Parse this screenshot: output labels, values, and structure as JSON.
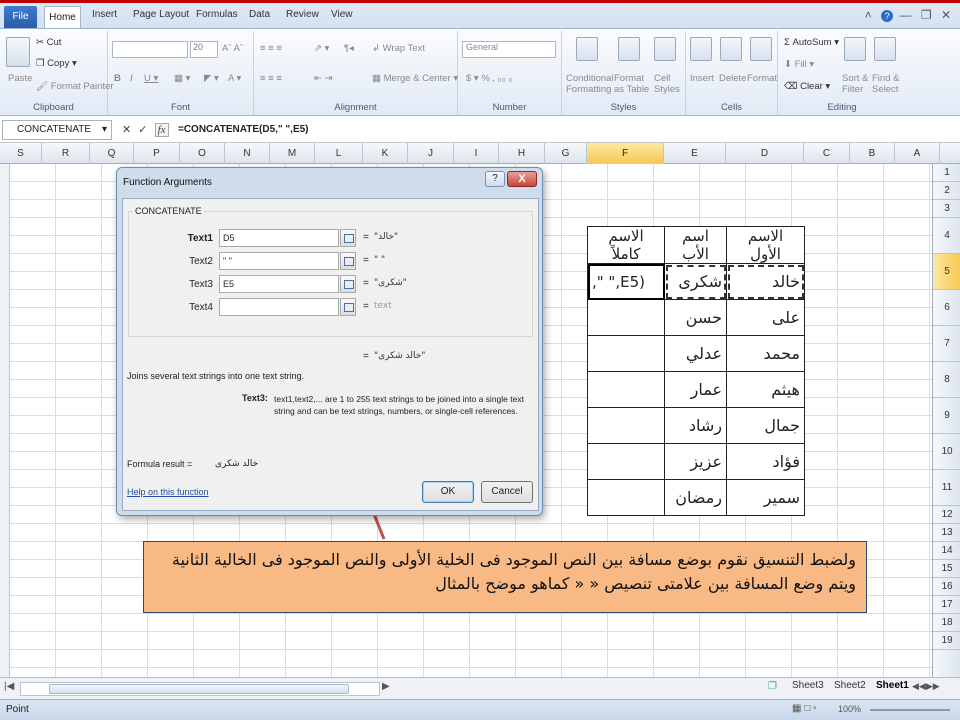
{
  "tabs": {
    "file": "File",
    "home": "Home",
    "items": [
      "Insert",
      "Page Layout",
      "Formulas",
      "Data",
      "Review",
      "View"
    ]
  },
  "ribbon": {
    "clipboard": {
      "label": "Clipboard",
      "paste": "Paste",
      "cut": "Cut",
      "copy": "Copy",
      "format_painter": "Format Painter"
    },
    "font": {
      "label": "Font",
      "size": "20"
    },
    "alignment": {
      "label": "Alignment",
      "wrap": "Wrap Text",
      "merge": "Merge & Center"
    },
    "number": {
      "label": "Number",
      "format": "General"
    },
    "styles": {
      "label": "Styles",
      "conditional": "Conditional",
      "conditional2": "Formatting",
      "format_as": "Format",
      "format_as2": "as Table",
      "cell_styles": "Cell",
      "cell_styles2": "Styles"
    },
    "cells": {
      "label": "Cells",
      "insert": "Insert",
      "delete": "Delete",
      "format": "Format"
    },
    "editing": {
      "label": "Editing",
      "autosum": "AutoSum",
      "fill": "Fill",
      "clear": "Clear",
      "sort": "Sort &",
      "sort2": "Filter",
      "find": "Find &",
      "find2": "Select"
    }
  },
  "formula_bar": {
    "name_box": "CONCATENATE",
    "formula": "=CONCATENATE(D5,\" \",E5)"
  },
  "columns": [
    "S",
    "R",
    "Q",
    "P",
    "O",
    "N",
    "M",
    "L",
    "K",
    "J",
    "I",
    "H",
    "G",
    "F",
    "E",
    "D",
    "C",
    "B",
    "A"
  ],
  "rows": [
    "1",
    "2",
    "3",
    "4",
    "5",
    "6",
    "7",
    "8",
    "9",
    "10",
    "11",
    "12",
    "13",
    "14",
    "15",
    "16",
    "17",
    "18",
    "19"
  ],
  "selected_column": "F",
  "selected_row": "5",
  "sheet": {
    "headers": {
      "full_name": "الاسم كاملاً",
      "father": "اسم الأب",
      "first": "الاسم الأول"
    },
    "rows": [
      {
        "full": ",\" \",E5)",
        "father": "شكرى",
        "first": "خالد"
      },
      {
        "full": "",
        "father": "حسن",
        "first": "على"
      },
      {
        "full": "",
        "father": "عدلي",
        "first": "محمد"
      },
      {
        "full": "",
        "father": "عمار",
        "first": "هيثم"
      },
      {
        "full": "",
        "father": "رشاد",
        "first": "جمال"
      },
      {
        "full": "",
        "father": "عزيز",
        "first": "فؤاد"
      },
      {
        "full": "",
        "father": "رمضان",
        "first": "سمير"
      }
    ]
  },
  "dialog": {
    "title": "Function Arguments",
    "help": "?",
    "close": "X",
    "function_name": "CONCATENATE",
    "args": [
      {
        "label": "Text1",
        "value": "D5",
        "result": "\"خالد\""
      },
      {
        "label": "Text2",
        "value": "\" \"",
        "result": "\" \""
      },
      {
        "label": "Text3",
        "value": "E5",
        "result": "\"شكرى\""
      },
      {
        "label": "Text4",
        "value": "",
        "result": "text"
      }
    ],
    "total_result": "\"خالد شكرى\"",
    "description": "Joins several text strings into one text string.",
    "arg_desc_name": "Text3:",
    "arg_desc": "text1,text2,... are 1 to 255 text strings to be joined into a single text string and can be text strings, numbers, or single-cell references.",
    "formula_result_label": "Formula result =",
    "formula_result": "خالد شكرى",
    "help_link": "Help on this function",
    "ok": "OK",
    "cancel": "Cancel"
  },
  "callout": {
    "text": "ولضبط التنسيق نقوم بوضع مسافة بين النص الموجود فى الخلية الأولى والنص الموجود فى الخالية الثانية  ويتم وضع المسافة بين علامتى تنصيص « « كماهو موضح بالمثال"
  },
  "sheet_tabs": [
    "Sheet3",
    "Sheet2",
    "Sheet1"
  ],
  "status": {
    "mode": "Point",
    "zoom": "100%"
  },
  "colors": {
    "callout": "#f9b985",
    "arrow": "#c0504d",
    "selected_header": "#f7c750"
  }
}
